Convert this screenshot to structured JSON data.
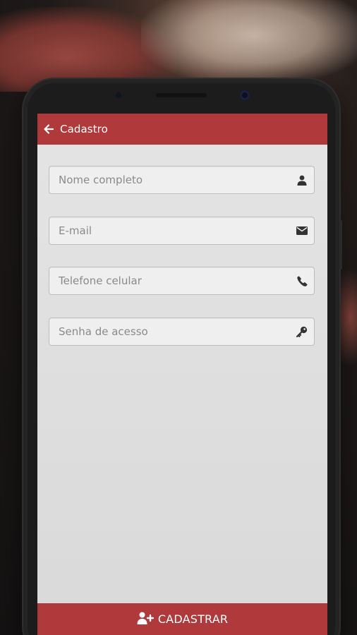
{
  "appbar": {
    "title": "Cadastro",
    "back_icon": "arrow-left-icon",
    "color": "#b0393c"
  },
  "form": {
    "fields": [
      {
        "placeholder": "Nome completo",
        "value": "",
        "icon": "user-icon",
        "type": "text"
      },
      {
        "placeholder": "E-mail",
        "value": "",
        "icon": "envelope-icon",
        "type": "email"
      },
      {
        "placeholder": "Telefone celular",
        "value": "",
        "icon": "phone-icon",
        "type": "tel"
      },
      {
        "placeholder": "Senha de acesso",
        "value": "",
        "icon": "key-icon",
        "type": "password"
      }
    ]
  },
  "submit": {
    "label": "CADASTRAR",
    "icon": "user-plus-icon",
    "color": "#b0393c"
  }
}
